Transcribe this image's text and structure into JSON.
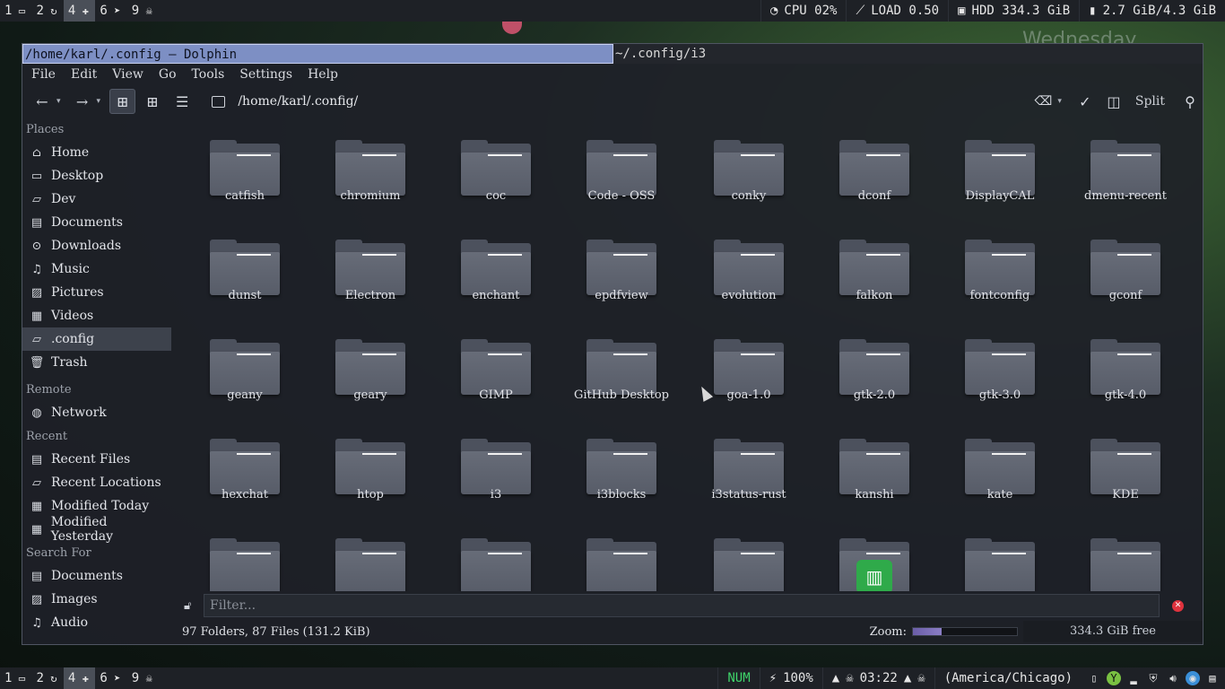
{
  "top_bar": {
    "workspaces": [
      {
        "num": "1",
        "icon": "terminal-icon"
      },
      {
        "num": "2",
        "icon": "refresh-icon"
      },
      {
        "num": "4",
        "icon": "puzzle-icon",
        "active": true
      },
      {
        "num": "6",
        "icon": "telegram-icon"
      },
      {
        "num": "9",
        "icon": "skull-icon"
      }
    ],
    "cpu": "CPU 02%",
    "load": "LOAD 0.50",
    "hdd": "HDD 334.3 GiB",
    "mem": "2.7 GiB/4.3 GiB"
  },
  "bottom_bar": {
    "num_lock": "NUM",
    "battery": "100%",
    "time": "03:22",
    "timezone": "(America/Chicago)"
  },
  "window": {
    "title_active": "/home/karl/.config — Dolphin",
    "title_inactive": "~/.config/i3",
    "menu": [
      "File",
      "Edit",
      "View",
      "Go",
      "Tools",
      "Settings",
      "Help"
    ],
    "location": "/home/karl/.config/",
    "split_label": "Split"
  },
  "sidebar": {
    "places_title": "Places",
    "places": [
      {
        "label": "Home",
        "icon": "home-icon"
      },
      {
        "label": "Desktop",
        "icon": "desktop-icon"
      },
      {
        "label": "Dev",
        "icon": "folder-icon"
      },
      {
        "label": "Documents",
        "icon": "documents-icon"
      },
      {
        "label": "Downloads",
        "icon": "downloads-icon"
      },
      {
        "label": "Music",
        "icon": "music-icon"
      },
      {
        "label": "Pictures",
        "icon": "pictures-icon"
      },
      {
        "label": "Videos",
        "icon": "videos-icon"
      },
      {
        "label": ".config",
        "icon": "folder-icon",
        "active": true
      },
      {
        "label": "Trash",
        "icon": "trash-icon"
      }
    ],
    "remote_title": "Remote",
    "remote": [
      {
        "label": "Network",
        "icon": "network-icon"
      }
    ],
    "recent_title": "Recent",
    "recent": [
      {
        "label": "Recent Files",
        "icon": "recent-files-icon"
      },
      {
        "label": "Recent Locations",
        "icon": "recent-locations-icon"
      },
      {
        "label": "Modified Today",
        "icon": "calendar-icon"
      },
      {
        "label": "Modified Yesterday",
        "icon": "calendar-icon"
      }
    ],
    "search_title": "Search For",
    "search": [
      {
        "label": "Documents",
        "icon": "documents-icon"
      },
      {
        "label": "Images",
        "icon": "images-icon"
      },
      {
        "label": "Audio",
        "icon": "audio-icon"
      }
    ]
  },
  "folders": [
    "catfish",
    "chromium",
    "coc",
    "Code - OSS",
    "conky",
    "dconf",
    "DisplayCAL",
    "dmenu-recent",
    "dunst",
    "Electron",
    "enchant",
    "epdfview",
    "evolution",
    "falkon",
    "fontconfig",
    "gconf",
    "geany",
    "geary",
    "GIMP",
    "GitHub Desktop",
    "goa-1.0",
    "gtk-2.0",
    "gtk-3.0",
    "gtk-4.0",
    "hexchat",
    "htop",
    "i3",
    "i3blocks",
    "i3status-rust",
    "kanshi",
    "kate",
    "KDE",
    "",
    "",
    "",
    "",
    "",
    "",
    "",
    ""
  ],
  "filter_placeholder": "Filter...",
  "status": {
    "count": "97 Folders, 87 Files (131.2 KiB)",
    "zoom_label": "Zoom:",
    "zoom_fraction": 0.28,
    "free": "334.3 GiB free"
  },
  "desktop": {
    "date_ghost": "Wednesday"
  }
}
